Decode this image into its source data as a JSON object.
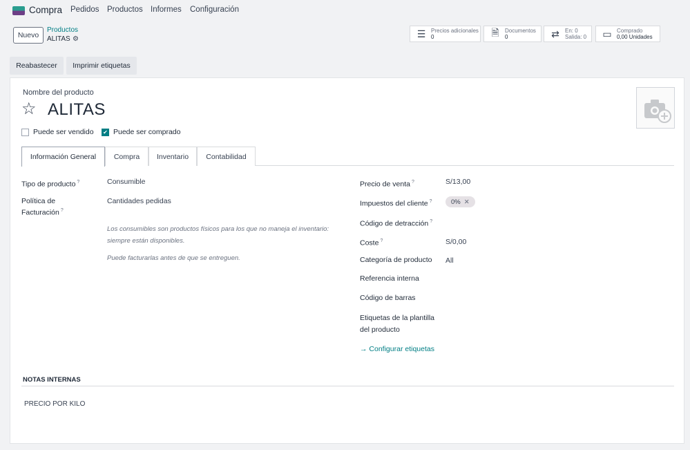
{
  "nav": {
    "app_name": "Compra",
    "menu": [
      "Pedidos",
      "Productos",
      "Informes",
      "Configuración"
    ]
  },
  "control": {
    "new_label": "Nuevo",
    "breadcrumb_parent": "Productos",
    "breadcrumb_current": "ALITAS"
  },
  "stats": {
    "precios_label": "Precios adicionales",
    "precios_value": "0",
    "documentos_label": "Documentos",
    "documentos_value": "0",
    "en_label": "En: 0",
    "salida_label": "Salida: 0",
    "comprado_label": "Comprado",
    "comprado_value": "0,00 Unidades"
  },
  "actions": {
    "reabastecer": "Reabastecer",
    "imprimir": "Imprimir etiquetas"
  },
  "product": {
    "name_label": "Nombre del producto",
    "name": "ALITAS",
    "can_be_sold_label": "Puede ser vendido",
    "can_be_sold": false,
    "can_be_purchased_label": "Puede ser comprado",
    "can_be_purchased": true
  },
  "tabs": [
    "Información General",
    "Compra",
    "Inventario",
    "Contabilidad"
  ],
  "general": {
    "tipo_label": "Tipo de producto",
    "tipo_value": "Consumible",
    "politica_label_1": "Política de",
    "politica_label_2": "Facturación",
    "politica_value": "Cantidades pedidas",
    "hint_1a": "Los consumibles son productos físicos para los que no maneja el inventario:",
    "hint_1b": "siempre están disponibles.",
    "hint_2": "Puede facturarlas antes de que se entreguen.",
    "precio_label": "Precio de venta",
    "precio_value": "S/13,00",
    "impuestos_label": "Impuestos del cliente",
    "impuestos_tag": "0%",
    "detraccion_label": "Código de detracción",
    "coste_label": "Coste",
    "coste_value": "S/0,00",
    "categoria_label": "Categoría de producto",
    "categoria_value": "All",
    "referencia_label": "Referencia interna",
    "barras_label": "Código de barras",
    "etiquetas_label_1": "Etiquetas de la plantilla",
    "etiquetas_label_2": "del producto",
    "configurar_link": "→  Configurar etiquetas",
    "help_mark": "?"
  },
  "notes": {
    "title": "NOTAS INTERNAS",
    "body": "PRECIO POR KILO"
  },
  "colors": {
    "accent": "#017e84",
    "brand_top": "#2a9d8f",
    "brand_bottom": "#6d3f86"
  }
}
